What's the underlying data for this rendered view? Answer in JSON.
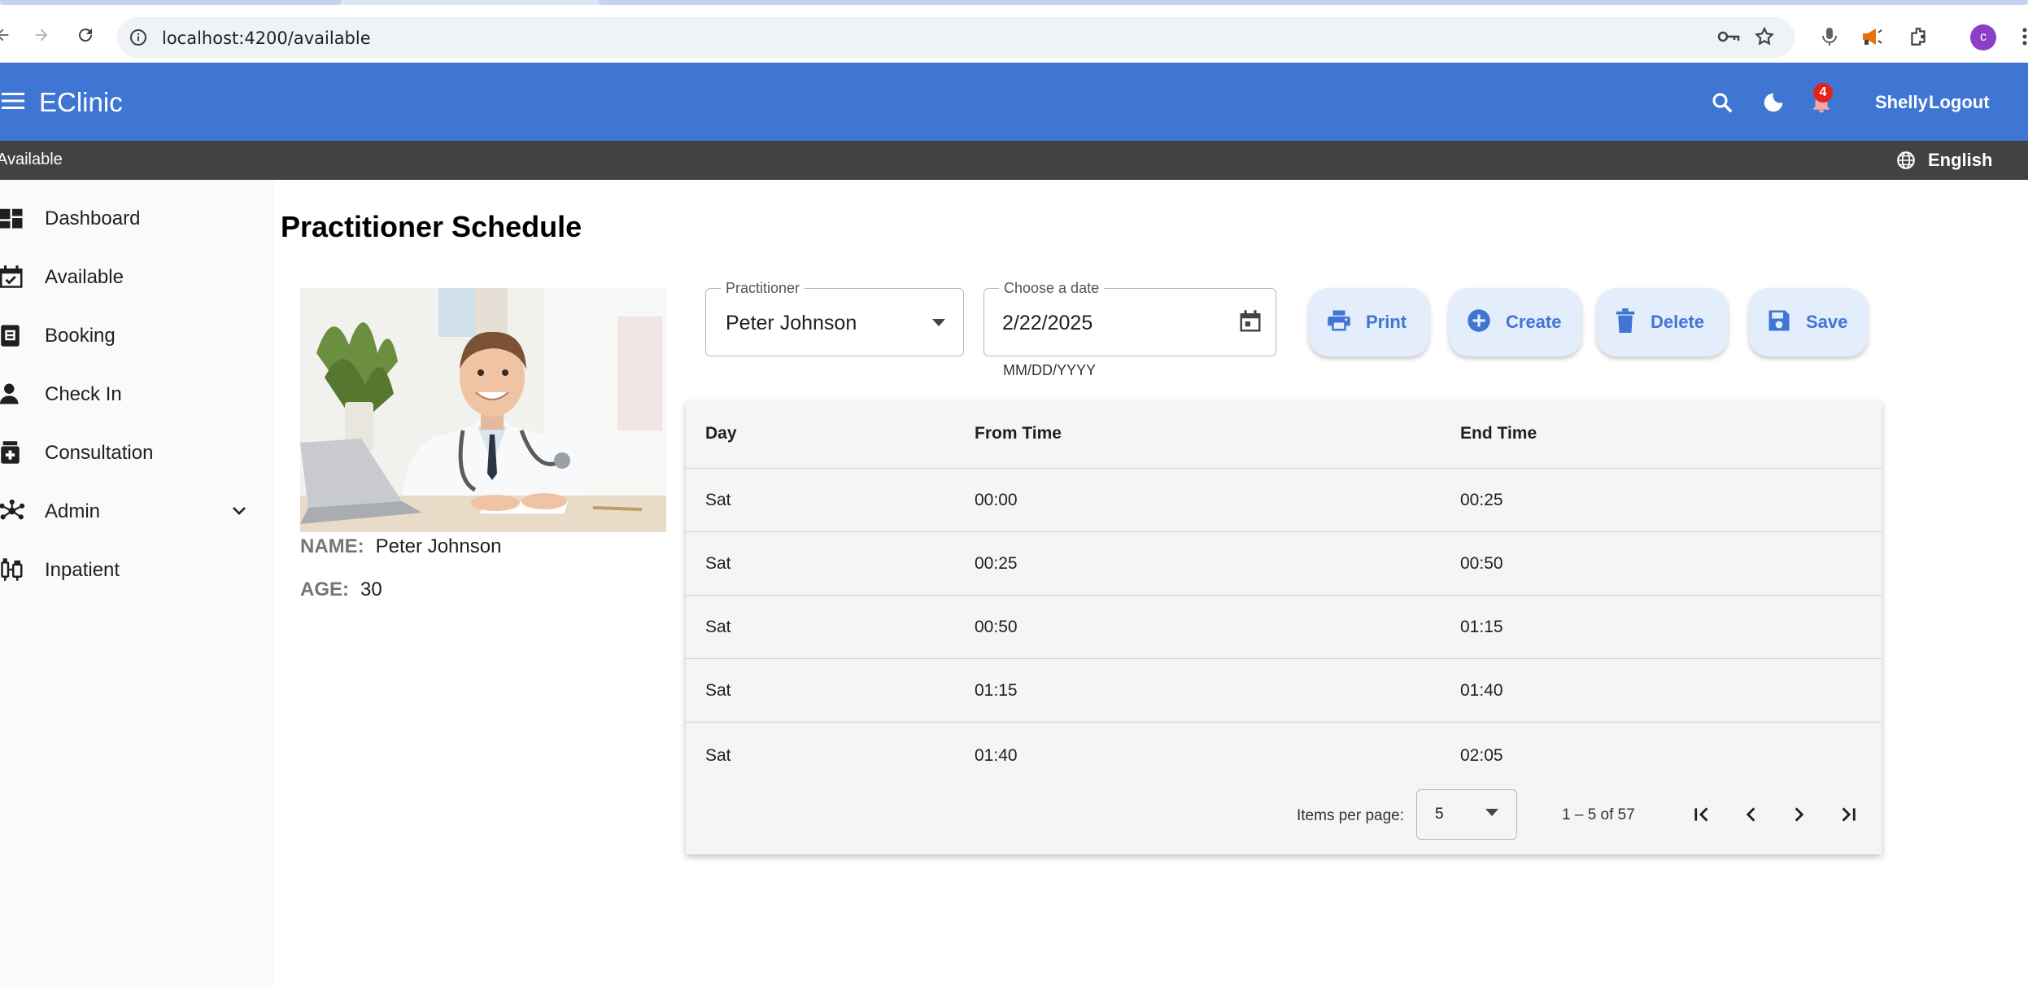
{
  "browser": {
    "url": "localhost:4200/available",
    "profile_initial": "c"
  },
  "app": {
    "title": "EClinic",
    "notification_count": "4",
    "user_name": "Shelly",
    "logout_label": "Logout",
    "breadcrumb": "Available",
    "language": "English"
  },
  "sidebar": {
    "items": [
      {
        "label": "Dashboard",
        "icon": "dashboard-icon"
      },
      {
        "label": "Available",
        "icon": "event-available-icon"
      },
      {
        "label": "Booking",
        "icon": "booking-icon"
      },
      {
        "label": "Check In",
        "icon": "person-icon"
      },
      {
        "label": "Consultation",
        "icon": "medication-icon"
      },
      {
        "label": "Admin",
        "icon": "hub-icon"
      },
      {
        "label": "Inpatient",
        "icon": "vaccines-icon"
      }
    ]
  },
  "main": {
    "page_title": "Practitioner Schedule",
    "profile": {
      "name_label": "NAME:",
      "name_value": "Peter Johnson",
      "age_label": "AGE:",
      "age_value": "30"
    },
    "practitioner_field": {
      "label": "Practitioner",
      "value": "Peter Johnson"
    },
    "date_field": {
      "label": "Choose a date",
      "value": "2/22/2025",
      "hint": "MM/DD/YYYY"
    },
    "actions": {
      "print": "Print",
      "create": "Create",
      "delete": "Delete",
      "save": "Save"
    },
    "table": {
      "headers": {
        "day": "Day",
        "from": "From Time",
        "end": "End Time"
      },
      "rows": [
        {
          "day": "Sat",
          "from": "00:00",
          "end": "00:25"
        },
        {
          "day": "Sat",
          "from": "00:25",
          "end": "00:50"
        },
        {
          "day": "Sat",
          "from": "00:50",
          "end": "01:15"
        },
        {
          "day": "Sat",
          "from": "01:15",
          "end": "01:40"
        },
        {
          "day": "Sat",
          "from": "01:40",
          "end": "02:05"
        }
      ]
    },
    "paginator": {
      "items_per_page_label": "Items per page:",
      "items_per_page": "5",
      "range": "1 – 5 of 57"
    }
  },
  "colors": {
    "toolbar": "#3f76d4",
    "subbar": "#424242",
    "button_bg": "#e3edfb",
    "accent": "#3f76d4"
  }
}
